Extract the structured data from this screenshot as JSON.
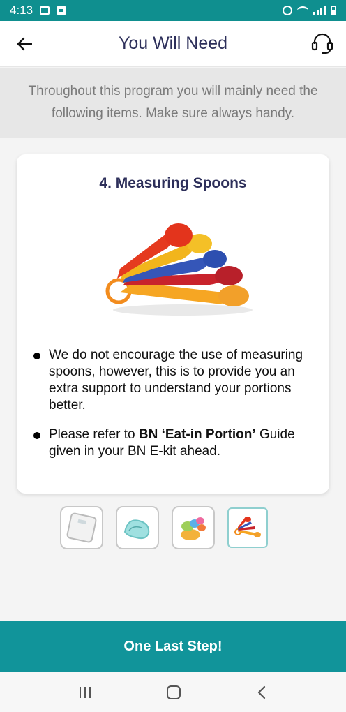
{
  "status_bar": {
    "time": "4:13"
  },
  "header": {
    "title": "You Will Need"
  },
  "intro": {
    "text": "Throughout this program you will mainly need the following items. Make sure always handy."
  },
  "card": {
    "title": "4. Measuring Spoons",
    "bullets": [
      {
        "text": "We do not encourage the use of measuring spoons, however, this is to provide you an extra support to understand your portions better."
      },
      {
        "before": "Please refer to ",
        "bold": "BN ‘Eat-in Portion’",
        "after": " Guide given in your BN E-kit ahead."
      }
    ]
  },
  "thumbnails": [
    {
      "name": "weighing-scale",
      "active": false
    },
    {
      "name": "measuring-tape",
      "active": false
    },
    {
      "name": "measuring-cups",
      "active": false
    },
    {
      "name": "measuring-spoons",
      "active": true
    }
  ],
  "cta": {
    "label": "One Last Step!"
  },
  "colors": {
    "teal": "#11949a",
    "status_teal": "#0f8f8f",
    "title_navy": "#2d2f5a",
    "intro_bg": "#e7e7e7"
  }
}
